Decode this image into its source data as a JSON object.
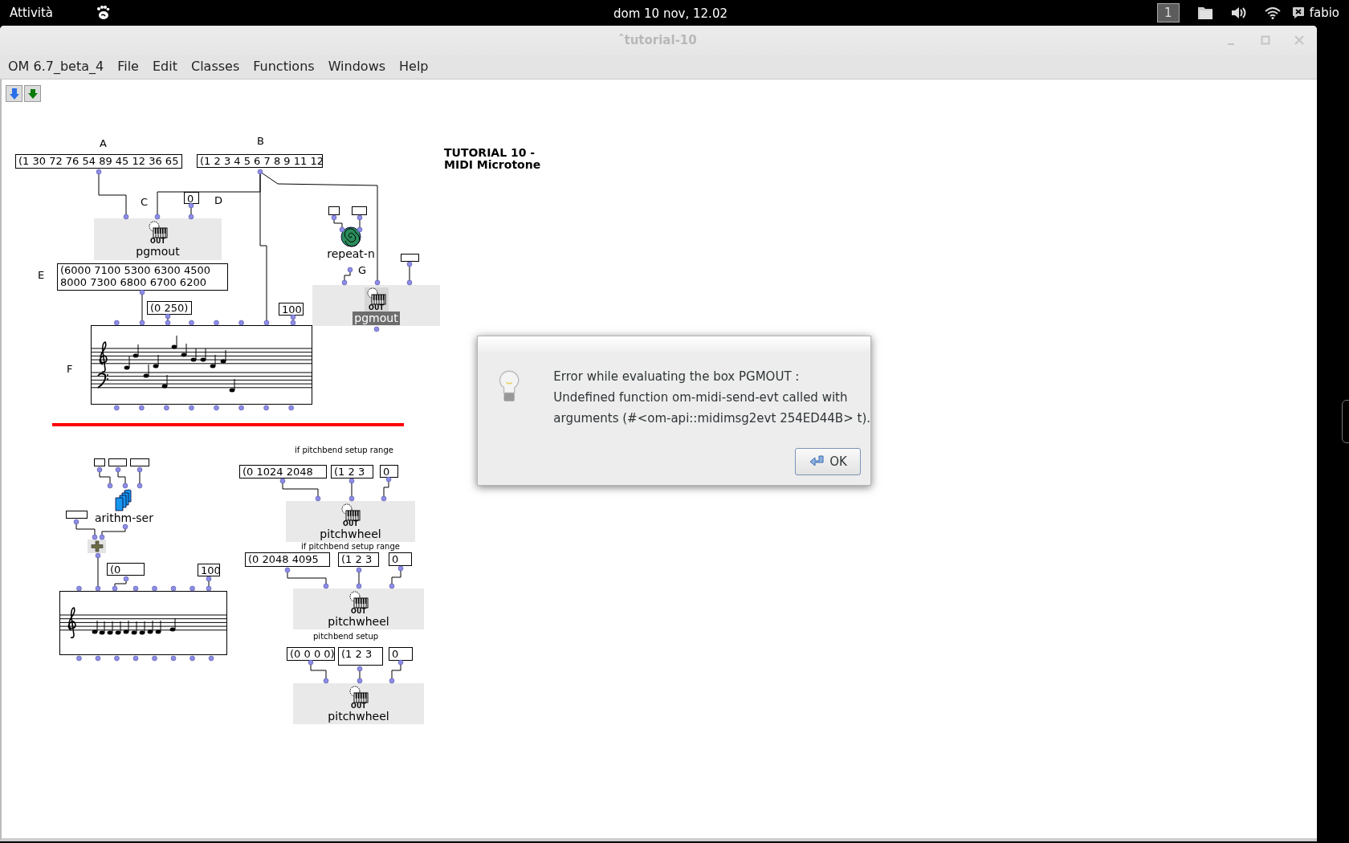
{
  "top_bar": {
    "activities": "Attività",
    "clock": "dom 10 nov, 12.02",
    "workspace": "1",
    "user": "fabio"
  },
  "window": {
    "title": "ˆtutorial-10"
  },
  "menu": [
    "OM 6.7_beta_4",
    "File",
    "Edit",
    "Classes",
    "Functions",
    "Windows",
    "Help"
  ],
  "patch": {
    "boxes": [
      {
        "kind": "label",
        "text": "A"
      },
      {
        "kind": "value",
        "text": "(1 30 72 76 54 89 45 12 36 65"
      },
      {
        "kind": "label",
        "text": "B"
      },
      {
        "kind": "value",
        "text": "(1 2 3 4 5 6 7 8 9 11 12"
      },
      {
        "kind": "label",
        "text": "C"
      },
      {
        "kind": "value",
        "text": "0"
      },
      {
        "kind": "label",
        "text": "D"
      },
      {
        "kind": "midi_out",
        "name": "pgmout",
        "badge": "OUT",
        "selected": false
      },
      {
        "kind": "label",
        "text": "E"
      },
      {
        "kind": "value",
        "lines": [
          "(6000 7100 5300 6300 4500",
          "8000 7300 6800 6700 6200"
        ]
      },
      {
        "kind": "value",
        "text": "(0 250)"
      },
      {
        "kind": "value",
        "text": "100"
      },
      {
        "kind": "label",
        "text": "F"
      },
      {
        "kind": "score"
      },
      {
        "kind": "value"
      },
      {
        "kind": "value"
      },
      {
        "kind": "repeat",
        "name": "repeat-n"
      },
      {
        "kind": "label",
        "text": "G"
      },
      {
        "kind": "value"
      },
      {
        "kind": "midi_out",
        "name": "pgmout",
        "badge": "OUT",
        "selected": true
      },
      {
        "kind": "comment",
        "lines": [
          "TUTORIAL 10 -",
          "MIDI Microtone"
        ]
      },
      {
        "kind": "note",
        "text": "if  pitchbend setup  range"
      },
      {
        "kind": "value",
        "text": "(0 1024 2048"
      },
      {
        "kind": "value",
        "text": "(1 2 3"
      },
      {
        "kind": "value",
        "text": "0"
      },
      {
        "kind": "midi_out",
        "name": "pitchwheel",
        "badge": "OUT",
        "selected": false
      },
      {
        "kind": "note",
        "text": "if  pitchbend setup  range"
      },
      {
        "kind": "value",
        "text": "(0 2048 4095"
      },
      {
        "kind": "value",
        "text": "(1 2 3"
      },
      {
        "kind": "value",
        "text": "0"
      },
      {
        "kind": "midi_out",
        "name": "pitchwheel",
        "badge": "OUT",
        "selected": false
      },
      {
        "kind": "note",
        "text": "pitchbend setup"
      },
      {
        "kind": "value",
        "text": "(0 0 0 0)"
      },
      {
        "kind": "value",
        "text": "(1 2 3"
      },
      {
        "kind": "value",
        "text": "0"
      },
      {
        "kind": "midi_out",
        "name": "pitchwheel",
        "badge": "OUT",
        "selected": false
      },
      {
        "kind": "value"
      },
      {
        "kind": "value"
      },
      {
        "kind": "value"
      },
      {
        "kind": "series",
        "name": "arithm-ser"
      },
      {
        "kind": "value"
      },
      {
        "kind": "plus"
      },
      {
        "kind": "value",
        "text": "(0"
      },
      {
        "kind": "value",
        "text": "100"
      },
      {
        "kind": "score"
      }
    ]
  },
  "dialog": {
    "lines": [
      "Error while evaluating the box PGMOUT :",
      "Undefined function om-midi-send-evt called with",
      "arguments (#<om-api::midimsg2evt 254ED44B> t)."
    ],
    "button": "OK"
  }
}
